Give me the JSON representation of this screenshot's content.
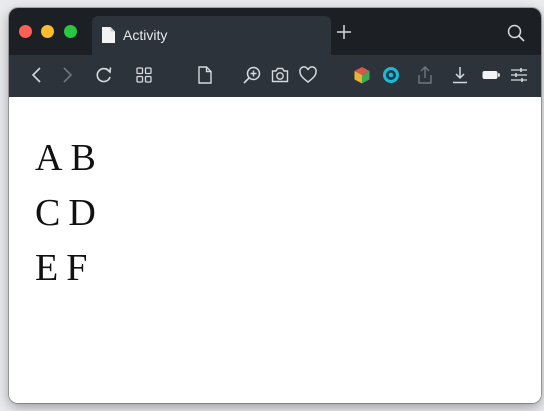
{
  "tab": {
    "title": "Activity"
  },
  "content": {
    "rows": [
      [
        "A",
        "B"
      ],
      [
        "C",
        "D"
      ],
      [
        "E",
        "F"
      ]
    ]
  },
  "colors": {
    "tabbar_bg": "#1c1f24",
    "toolbar_bg": "#2c333b",
    "accent_teal": "#1bbbd6",
    "traffic_red": "#fe5f57",
    "traffic_yellow": "#febc2e",
    "traffic_green": "#28c840"
  },
  "icons": [
    "back-icon",
    "forward-icon",
    "reload-icon",
    "grid-icon",
    "document-icon",
    "zoom-in-icon",
    "camera-icon",
    "heart-icon",
    "cube-extension-icon",
    "record-extension-icon",
    "share-icon",
    "download-icon",
    "battery-icon",
    "sliders-icon"
  ]
}
